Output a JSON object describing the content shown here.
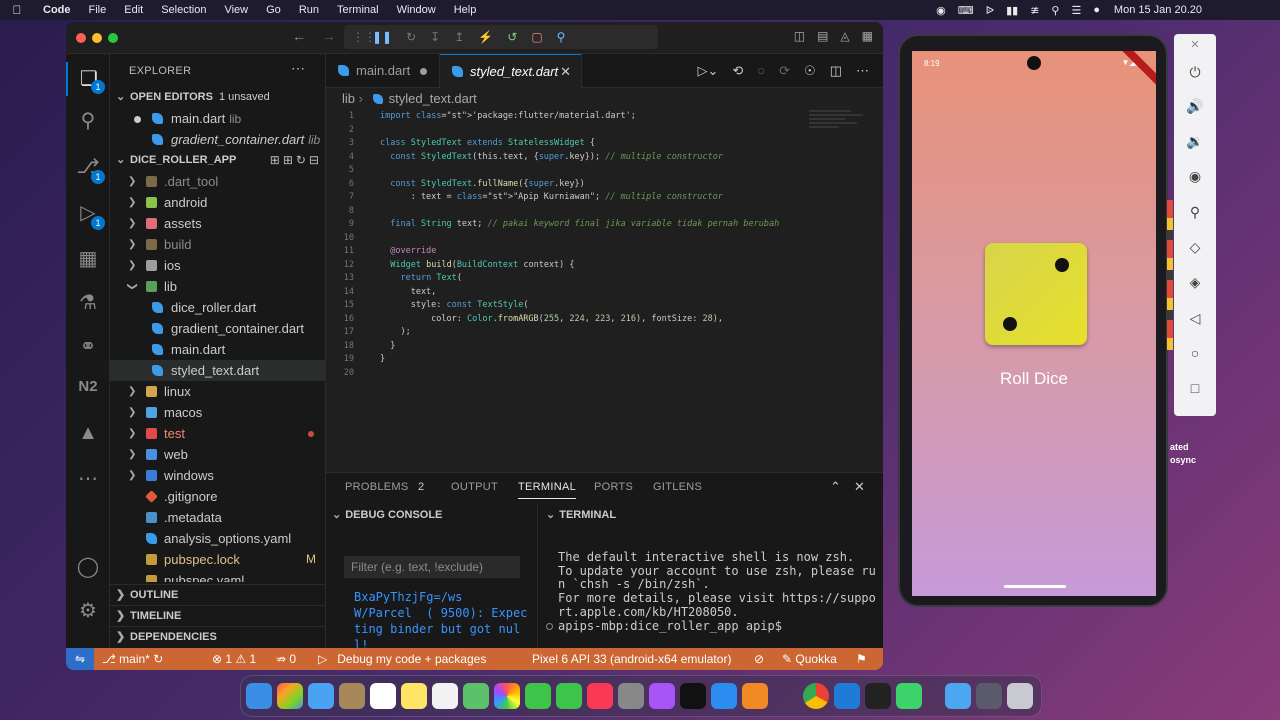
{
  "menubar": {
    "app_name": "Code",
    "menus": [
      "File",
      "Edit",
      "Selection",
      "View",
      "Go",
      "Run",
      "Terminal",
      "Window",
      "Help"
    ],
    "clock": "Mon 15 Jan  20.20"
  },
  "vscode": {
    "activity_badges": [
      "1",
      "1",
      "1"
    ],
    "explorer_title": "EXPLORER",
    "open_editors": {
      "title": "OPEN EDITORS",
      "unsaved": "1 unsaved",
      "items": [
        {
          "name": "main.dart",
          "desc": "lib"
        },
        {
          "name": "gradient_container.dart",
          "desc": "lib"
        }
      ]
    },
    "project": {
      "title": "DICE_ROLLER_APP",
      "items": [
        {
          "label": ".dart_tool"
        },
        {
          "label": "android"
        },
        {
          "label": "assets"
        },
        {
          "label": "build"
        },
        {
          "label": "ios"
        },
        {
          "label": "lib"
        },
        {
          "label": "dice_roller.dart"
        },
        {
          "label": "gradient_container.dart"
        },
        {
          "label": "main.dart"
        },
        {
          "label": "styled_text.dart"
        },
        {
          "label": "linux"
        },
        {
          "label": "macos"
        },
        {
          "label": "test"
        },
        {
          "label": "web"
        },
        {
          "label": "windows"
        },
        {
          "label": ".gitignore"
        },
        {
          "label": ".metadata"
        },
        {
          "label": "analysis_options.yaml"
        },
        {
          "label": "pubspec.lock",
          "badge": "M"
        },
        {
          "label": "pubspec.yaml"
        }
      ]
    },
    "bottom_sections": [
      "OUTLINE",
      "TIMELINE",
      "DEPENDENCIES"
    ],
    "tabs": [
      {
        "label": "main.dart"
      },
      {
        "label": "styled_text.dart"
      }
    ],
    "breadcrumb": {
      "folder": "lib",
      "file": "styled_text.dart"
    },
    "code_lines": [
      "import 'package:flutter/material.dart';",
      "",
      "class StyledText extends StatelessWidget {",
      "  const StyledText(this.text, {super.key}); // multiple constructor",
      "",
      "  const StyledText.fullName({super.key})",
      "      : text = \"Apip Kurniawan\"; // multiple constructor",
      "",
      "  final String text; // pakai keyword final jika variable tidak pernah berubah",
      "",
      "  @override",
      "  Widget build(BuildContext context) {",
      "    return Text(",
      "      text,",
      "      style: const TextStyle(",
      "          color: Color.fromARGB(255, 224, 223, 216), fontSize: 28),",
      "    );",
      "  }",
      "}",
      ""
    ],
    "panel": {
      "tabs": [
        "PROBLEMS",
        "OUTPUT",
        "TERMINAL",
        "PORTS",
        "GITLENS"
      ],
      "problems_count": "2",
      "debug_console_title": "DEBUG CONSOLE",
      "filter_placeholder": "Filter (e.g. text, !exclude)",
      "debug_output": "BxaPyThzjFg=/ws\nW/Parcel  ( 9500): Expec\nting binder but got nul\nl!",
      "terminal_title": "TERMINAL",
      "terminal_output": "The default interactive shell is now zsh.\nTo update your account to use zsh, please ru\nn `chsh -s /bin/zsh`.\nFor more details, please visit https://suppo\nrt.apple.com/kb/HT208050.\napips-mbp:dice_roller_app apip$"
    },
    "status": {
      "branch": "main*",
      "errors": "1",
      "warnings": "1",
      "ports": "0",
      "debug": "Debug my code + packages",
      "device": "Pixel 6 API 33 (android-x64 emulator)",
      "quokka": "Quokka"
    }
  },
  "emulator": {
    "time": "8:19",
    "button_label": "Roll Dice",
    "side_text": [
      "ated",
      "osync"
    ]
  },
  "colors": {
    "status_bar": "#cc6633",
    "accent": "#0078d4",
    "dice": "#e6e12a"
  }
}
